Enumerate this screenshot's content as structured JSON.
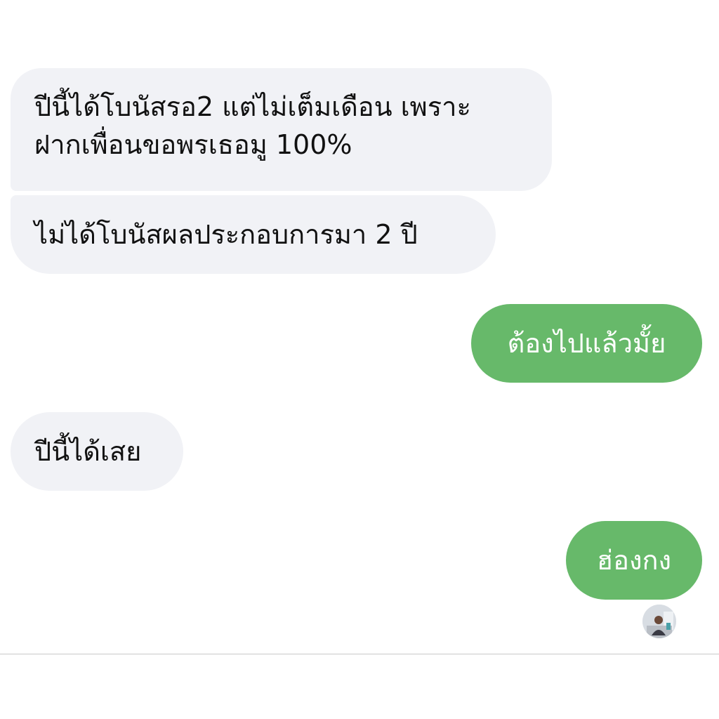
{
  "messages": [
    {
      "direction": "incoming",
      "lines": [
        "ปีนี้ได้โบนัสรอ2 แต่ไม่เต็มเดือน เพราะ",
        "ฝากเพื่อนขอพรเธอมู 100%"
      ]
    },
    {
      "direction": "incoming",
      "text": "ไม่ได้โบนัสผลประกอบการมา 2 ปี"
    },
    {
      "direction": "outgoing",
      "text": "ต้องไปแล้วมั้ย"
    },
    {
      "direction": "incoming",
      "text": "ปีนี้ได้เสย"
    },
    {
      "direction": "outgoing",
      "text": "ฮ่องกง"
    }
  ],
  "read_receipt": {
    "icon": "avatar-icon"
  },
  "colors": {
    "incoming_bubble": "#f1f2f6",
    "outgoing_bubble": "#67b96a",
    "incoming_text": "#111111",
    "outgoing_text": "#ffffff",
    "background": "#ffffff"
  }
}
